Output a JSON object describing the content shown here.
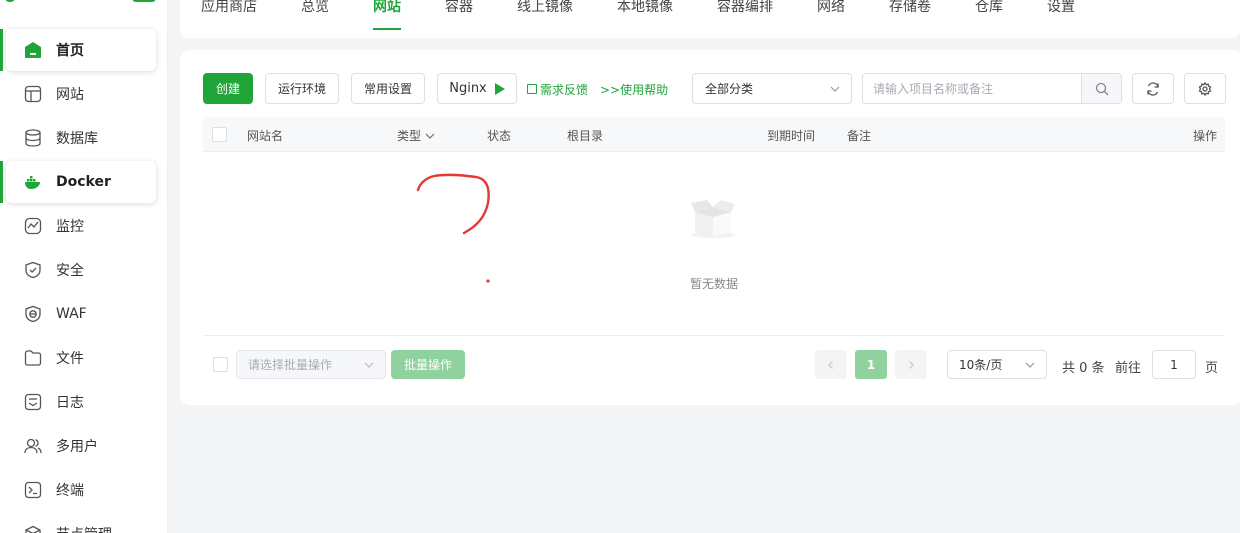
{
  "sidebar": {
    "items": [
      {
        "label": "首页",
        "icon": "home-icon"
      },
      {
        "label": "网站",
        "icon": "website-icon"
      },
      {
        "label": "数据库",
        "icon": "database-icon"
      },
      {
        "label": "Docker",
        "icon": "docker-icon"
      },
      {
        "label": "监控",
        "icon": "monitor-icon"
      },
      {
        "label": "安全",
        "icon": "shield-icon"
      },
      {
        "label": "WAF",
        "icon": "waf-icon"
      },
      {
        "label": "文件",
        "icon": "folder-icon"
      },
      {
        "label": "日志",
        "icon": "log-icon"
      },
      {
        "label": "多用户",
        "icon": "users-icon"
      },
      {
        "label": "终端",
        "icon": "terminal-icon"
      },
      {
        "label": "节点管理",
        "icon": "node-icon"
      }
    ]
  },
  "tabs": [
    "应用商店",
    "总览",
    "网站",
    "容器",
    "线上镜像",
    "本地镜像",
    "容器编排",
    "网络",
    "存储卷",
    "仓库",
    "设置"
  ],
  "toolbar": {
    "create_label": "创建",
    "runtime_label": "运行环境",
    "settings_label": "常用设置",
    "nginx_label": "Nginx",
    "feedback_label": "需求反馈",
    "help_label": ">>使用帮助",
    "category_select": "全部分类",
    "search_placeholder": "请输入项目名称或备注"
  },
  "table": {
    "columns": [
      "网站名",
      "类型",
      "状态",
      "根目录",
      "到期时间",
      "备注",
      "操作"
    ],
    "empty_text": "暂无数据"
  },
  "footer": {
    "batch_placeholder": "请选择批量操作",
    "batch_button": "批量操作",
    "current_page": "1",
    "page_size": "10条/页",
    "total": "共 0 条",
    "goto_prefix": "前往",
    "goto_value": "1",
    "goto_suffix": "页"
  },
  "colors": {
    "accent": "#20a53a",
    "accent_light": "#90d29d",
    "annotation": "#e53935"
  }
}
